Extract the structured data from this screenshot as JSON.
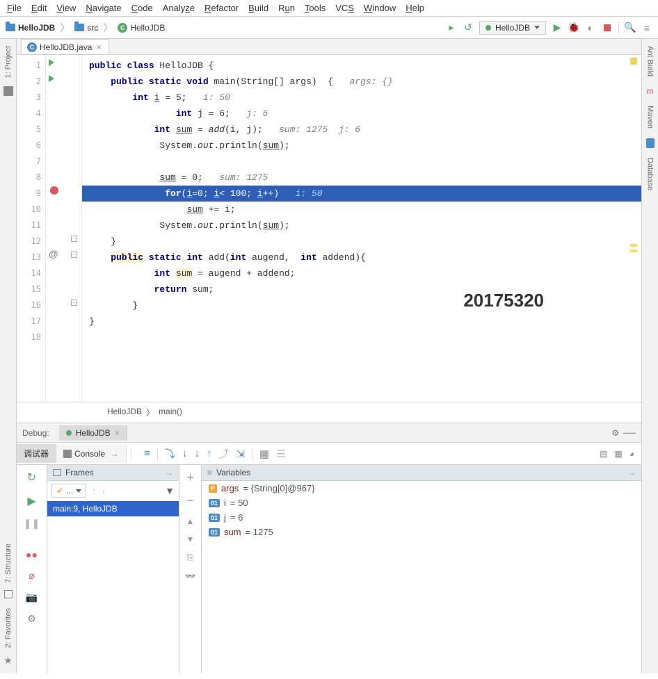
{
  "menu": {
    "file": "File",
    "edit": "Edit",
    "view": "View",
    "navigate": "Navigate",
    "code": "Code",
    "analyze": "Analyze",
    "refactor": "Refactor",
    "build": "Build",
    "run": "Run",
    "tools": "Tools",
    "vcs": "VCS",
    "window": "Window",
    "help": "Help"
  },
  "breadcrumb": {
    "project": "HelloJDB",
    "src": "src",
    "classIcon": "C",
    "className": "HelloJDB"
  },
  "runConfig": {
    "name": "HelloJDB"
  },
  "editor": {
    "tabName": "HelloJDB.java",
    "lines": [
      {
        "n": 1,
        "html": "<span class='kw'>public class</span> HelloJDB {"
      },
      {
        "n": 2,
        "html": "    <span class='kw'>public static void</span> main(String[] args)  {   <span class='comment'>args: {}</span>"
      },
      {
        "n": 3,
        "html": "        <span class='kw'>int</span> <span class='underline'>i</span> = 5;   <span class='comment'>i: 50</span>"
      },
      {
        "n": 4,
        "html": "                <span class='kw'>int</span> j = 6;   <span class='comment'>j: 6</span>"
      },
      {
        "n": 5,
        "html": "            <span class='kw'>int</span> <span class='underline'>sum</span> = <span class='italic-call'>add</span>(i, j);   <span class='comment'>sum: 1275  j: 6</span>"
      },
      {
        "n": 6,
        "html": "             System.<span class='italic-call'>out</span>.println(<span class='underline'>sum</span>);"
      },
      {
        "n": 7,
        "html": ""
      },
      {
        "n": 8,
        "html": "             <span class='underline'>sum</span> = 0;   <span class='comment'>sum: 1275</span>"
      },
      {
        "n": 9,
        "hl": true,
        "html": "              <span class='kw'>for</span>(<span class='underline'>i</span>=0; <span class='underline'>i</span>&lt; 100; <span class='underline'>i</span>++)   <span class='comment'>i: 50</span>"
      },
      {
        "n": 10,
        "html": "                  <span class='underline'>sum</span> += i;"
      },
      {
        "n": 11,
        "html": "             System.<span class='italic-call'>out</span>.println(<span class='underline'>sum</span>);"
      },
      {
        "n": 12,
        "html": "    }"
      },
      {
        "n": 13,
        "html": "    <span class='hl-yellow'><span class='kw'>public</span></span> <span class='kw'>static int</span> add(<span class='kw'>int</span> augend,  <span class='kw'>int</span> addend){"
      },
      {
        "n": 14,
        "html": "            <span class='kw'>int</span> <span class='hl-yellow'>sum</span> = augend + addend;"
      },
      {
        "n": 15,
        "html": "            <span class='kw'>return</span> sum;"
      },
      {
        "n": 16,
        "html": "        }"
      },
      {
        "n": 17,
        "html": "}"
      },
      {
        "n": 18,
        "html": ""
      }
    ],
    "watermark": "20175320",
    "crumbClass": "HelloJDB",
    "crumbMethod": "main()"
  },
  "sideTabs": {
    "project": "1: Project",
    "structure": "7: Structure",
    "favorites": "2: Favorites",
    "antBuild": "Ant Build",
    "maven": "Maven",
    "database": "Database"
  },
  "debug": {
    "title": "Debug:",
    "tabName": "HelloJDB",
    "tab1": "调试器",
    "tab2": "Console",
    "framesTitle": "Frames",
    "varsTitle": "Variables",
    "comboText": "...",
    "frameRow": "main:9, HelloJDB",
    "vars": [
      {
        "badge": "P",
        "badgeCls": "",
        "name": "args",
        "val": " = {String[0]@967}"
      },
      {
        "badge": "01",
        "badgeCls": "blue",
        "name": "i",
        "val": " = 50"
      },
      {
        "badge": "01",
        "badgeCls": "blue",
        "name": "j",
        "val": " = 6"
      },
      {
        "badge": "01",
        "badgeCls": "blue",
        "name": "sum",
        "val": " = 1275"
      }
    ]
  }
}
